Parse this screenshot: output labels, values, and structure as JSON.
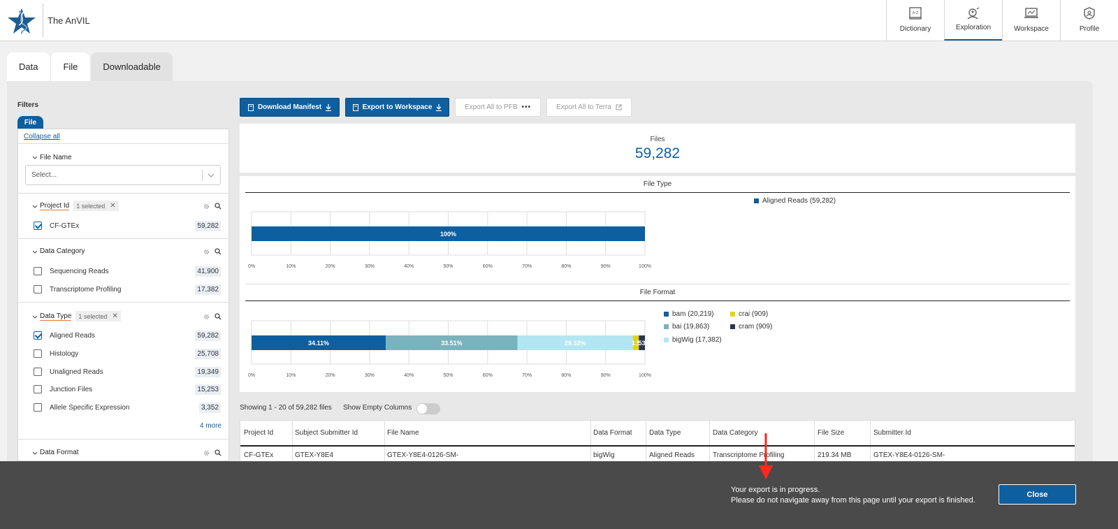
{
  "header": {
    "app_title": "The AnVIL",
    "nav": [
      {
        "label": "Dictionary",
        "icon": "dictionary-icon"
      },
      {
        "label": "Exploration",
        "icon": "exploration-icon",
        "active": true
      },
      {
        "label": "Workspace",
        "icon": "workspace-icon"
      },
      {
        "label": "Profile",
        "icon": "profile-icon"
      }
    ]
  },
  "tabs": [
    "Data",
    "File",
    "Downloadable"
  ],
  "filters": {
    "title": "Filters",
    "chip": "File",
    "collapse_all": "Collapse all",
    "file_name": {
      "label": "File Name",
      "placeholder": "Select..."
    },
    "project_id": {
      "label": "Project Id",
      "badge": "1 selected",
      "options": [
        {
          "label": "CF-GTEx",
          "count": "59,282",
          "checked": true
        }
      ]
    },
    "data_category": {
      "label": "Data Category",
      "options": [
        {
          "label": "Sequencing Reads",
          "count": "41,900"
        },
        {
          "label": "Transcriptome Profiling",
          "count": "17,382"
        }
      ]
    },
    "data_type": {
      "label": "Data Type",
      "badge": "1 selected",
      "options": [
        {
          "label": "Aligned Reads",
          "count": "59,282",
          "checked": true
        },
        {
          "label": "Histology",
          "count": "25,708"
        },
        {
          "label": "Unaligned Reads",
          "count": "19,349"
        },
        {
          "label": "Junction Files",
          "count": "15,253"
        },
        {
          "label": "Allele Specific Expression",
          "count": "3,352"
        }
      ],
      "more": "4 more"
    },
    "data_format": {
      "label": "Data Format"
    }
  },
  "buttons": {
    "download_manifest": "Download Manifest",
    "export_workspace": "Export to Workspace",
    "export_pfb": "Export All to PFB",
    "export_terra": "Export All to Terra"
  },
  "summary": {
    "label": "Files",
    "value": "59,282"
  },
  "chart_data": [
    {
      "type": "bar",
      "title": "File Type",
      "orientation": "horizontal-stacked",
      "series": [
        {
          "name": "Aligned Reads (59,282)",
          "values": [
            100
          ],
          "label": "100%",
          "color": "#0e5fa0"
        }
      ],
      "x_ticks": [
        "0%",
        "10%",
        "20%",
        "30%",
        "40%",
        "50%",
        "60%",
        "70%",
        "80%",
        "90%",
        "100%"
      ],
      "xlim": [
        0,
        100
      ]
    },
    {
      "type": "bar",
      "title": "File Format",
      "orientation": "horizontal-stacked",
      "series": [
        {
          "name": "bam (20,219)",
          "values": [
            34.11
          ],
          "label": "34.11%",
          "color": "#0e5fa0"
        },
        {
          "name": "bai (19,863)",
          "values": [
            33.51
          ],
          "label": "33.51%",
          "color": "#7ab3bd"
        },
        {
          "name": "bigWig (17,382)",
          "values": [
            29.32
          ],
          "label": "29.32%",
          "color": "#b2e6f2"
        },
        {
          "name": "crai (909)",
          "values": [
            1.53
          ],
          "label": "1.5",
          "color": "#e2d41b"
        },
        {
          "name": "cram (909)",
          "values": [
            1.53
          ],
          "label": "53",
          "color": "#2a3556"
        }
      ],
      "x_ticks": [
        "0%",
        "10%",
        "20%",
        "30%",
        "40%",
        "50%",
        "60%",
        "70%",
        "80%",
        "90%",
        "100%"
      ],
      "xlim": [
        0,
        100
      ]
    }
  ],
  "table": {
    "showing": "Showing 1 - 20 of 59,282 files",
    "show_empty": "Show Empty Columns",
    "columns": [
      "Project Id",
      "Subject Submitter Id",
      "File Name",
      "Data Format",
      "Data Type",
      "Data Category",
      "File Size",
      "Submitter Id"
    ],
    "rows": [
      [
        "CF-GTEx",
        "GTEX-Y8E4",
        "GTEX-Y8E4-0126-SM-",
        "bigWig",
        "Aligned Reads",
        "Transcriptome Profiling",
        "219.34 MB",
        "GTEX-Y8E4-0126-SM-"
      ]
    ]
  },
  "notice": {
    "line1": "Your export is in progress.",
    "line2": "Please do not navigate away from this page until your export is finished.",
    "close": "Close"
  },
  "colors": {
    "brand": "#0e5fa0",
    "annotation_arrow": "#ff2a1a"
  }
}
